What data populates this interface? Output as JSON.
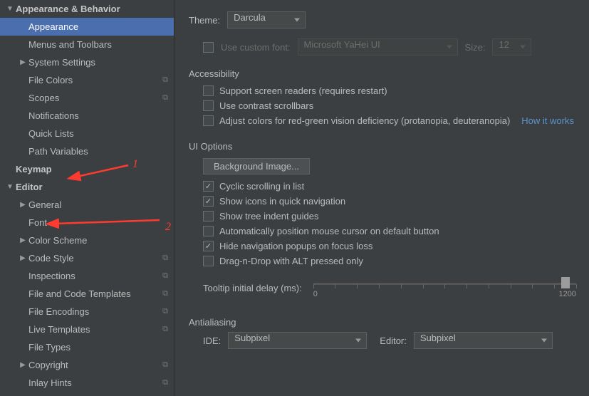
{
  "sidebar": {
    "items": [
      {
        "label": "Appearance & Behavior",
        "bold": true,
        "arrow": "down",
        "indent": 0
      },
      {
        "label": "Appearance",
        "indent": 1,
        "selected": true
      },
      {
        "label": "Menus and Toolbars",
        "indent": 1
      },
      {
        "label": "System Settings",
        "arrow": "right",
        "indent": 1
      },
      {
        "label": "File Colors",
        "indent": 1,
        "badge": "⧉"
      },
      {
        "label": "Scopes",
        "indent": 1,
        "badge": "⧉"
      },
      {
        "label": "Notifications",
        "indent": 1
      },
      {
        "label": "Quick Lists",
        "indent": 1
      },
      {
        "label": "Path Variables",
        "indent": 1
      },
      {
        "label": "Keymap",
        "bold": true,
        "indent": 0
      },
      {
        "label": "Editor",
        "bold": true,
        "arrow": "down",
        "indent": 0
      },
      {
        "label": "General",
        "arrow": "right",
        "indent": 1
      },
      {
        "label": "Font",
        "indent": 1
      },
      {
        "label": "Color Scheme",
        "arrow": "right",
        "indent": 1
      },
      {
        "label": "Code Style",
        "arrow": "right",
        "indent": 1,
        "badge": "⧉"
      },
      {
        "label": "Inspections",
        "indent": 1,
        "badge": "⧉"
      },
      {
        "label": "File and Code Templates",
        "indent": 1,
        "badge": "⧉"
      },
      {
        "label": "File Encodings",
        "indent": 1,
        "badge": "⧉"
      },
      {
        "label": "Live Templates",
        "indent": 1,
        "badge": "⧉"
      },
      {
        "label": "File Types",
        "indent": 1
      },
      {
        "label": "Copyright",
        "arrow": "right",
        "indent": 1,
        "badge": "⧉"
      },
      {
        "label": "Inlay Hints",
        "indent": 1,
        "badge": "⧉"
      }
    ]
  },
  "main": {
    "theme_label": "Theme:",
    "theme_value": "Darcula",
    "custom_font_label": "Use custom font:",
    "custom_font_value": "Microsoft YaHei UI",
    "size_label": "Size:",
    "size_value": "12",
    "accessibility_title": "Accessibility",
    "acc_screen_readers": "Support screen readers (requires restart)",
    "acc_contrast": "Use contrast scrollbars",
    "acc_color": "Adjust colors for red-green vision deficiency (protanopia, deuteranopia)",
    "how_it_works": "How it works",
    "ui_options_title": "UI Options",
    "bg_image_btn": "Background Image...",
    "opt_cyclic": "Cyclic scrolling in list",
    "opt_icons": "Show icons in quick navigation",
    "opt_tree": "Show tree indent guides",
    "opt_mouse": "Automatically position mouse cursor on default button",
    "opt_hide": "Hide navigation popups on focus loss",
    "opt_drag": "Drag-n-Drop with ALT pressed only",
    "tooltip_label": "Tooltip initial delay (ms):",
    "slider_min": "0",
    "slider_max": "1200",
    "antialiasing_title": "Antialiasing",
    "ide_label": "IDE:",
    "ide_value": "Subpixel",
    "editor_label": "Editor:",
    "editor_value": "Subpixel"
  },
  "annotations": {
    "num1": "1",
    "num2": "2"
  }
}
